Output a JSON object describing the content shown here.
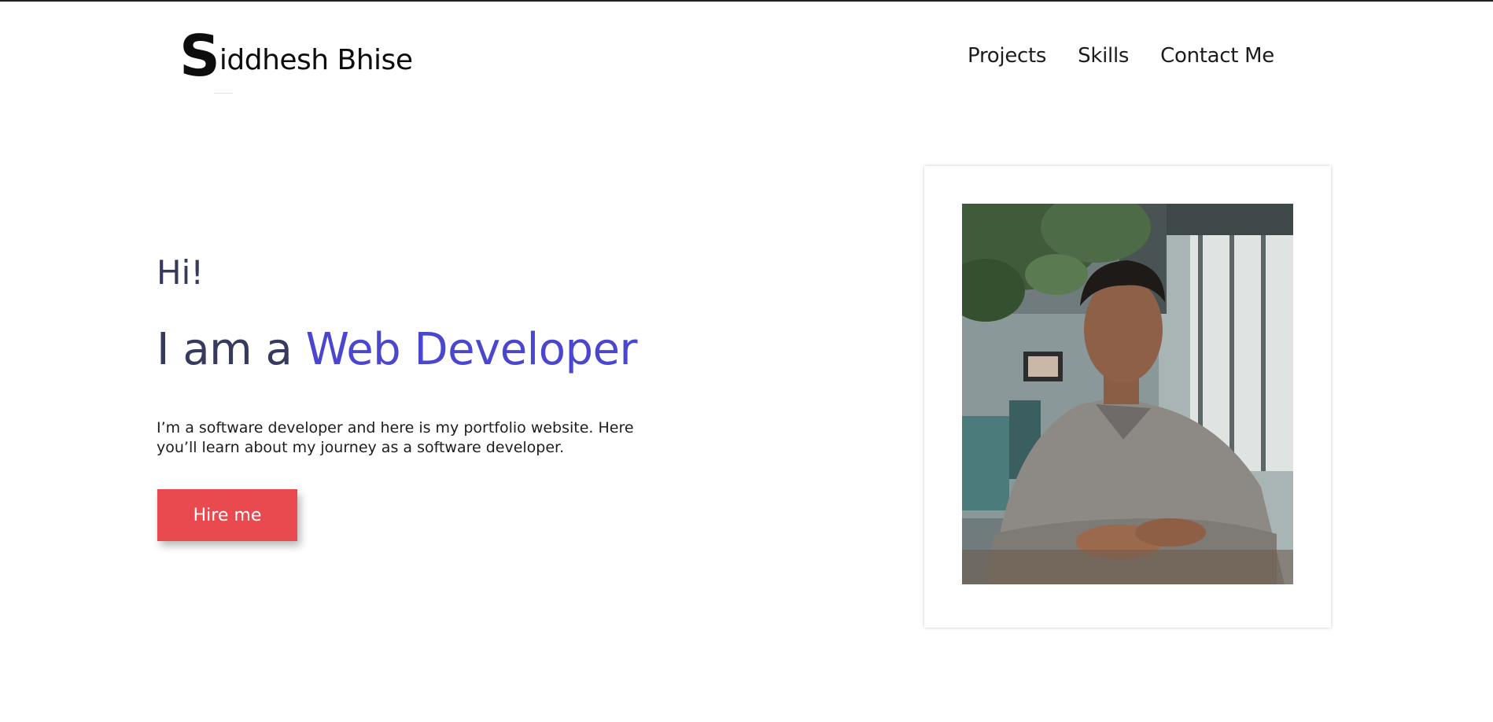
{
  "header": {
    "logo_initial": "S",
    "logo_rest": "iddhesh Bhise",
    "nav": [
      {
        "label": "Projects"
      },
      {
        "label": "Skills"
      },
      {
        "label": "Contact Me"
      }
    ]
  },
  "hero": {
    "greeting": "Hi!",
    "headline_prefix": "I am a ",
    "headline_accent": "Web Developer",
    "description": "I’m a software developer and here is my portfolio website. Here you’ll learn about my journey as a software developer.",
    "cta_label": "Hire me"
  },
  "colors": {
    "accent": "#4b46cf",
    "heading": "#363a5c",
    "cta": "#e84a4f"
  }
}
